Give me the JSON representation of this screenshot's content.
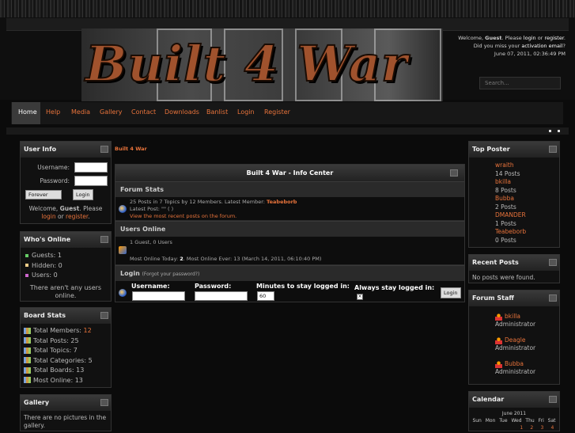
{
  "welcome": {
    "prefix": "Welcome, ",
    "user": "Guest",
    "mid": ". Please ",
    "login": "login",
    "or": " or ",
    "register": "register",
    "end": ".",
    "line2a": "Did you miss your ",
    "activation": "activation email",
    "line2b": "?",
    "date": "June 07, 2011, 02:36:49 PM"
  },
  "logo_text": "Built 4 War",
  "search_placeholder": "Search...",
  "nav": [
    "Home",
    "Help",
    "Media",
    "Gallery",
    "Contact",
    "Downloads",
    "Banlist",
    "Login",
    "Register"
  ],
  "breadcrumb": "Built 4 War",
  "userinfo": {
    "title": "User Info",
    "username": "Username:",
    "password": "Password:",
    "forever": "Forever",
    "login_btn": "Login",
    "w1": "Welcome, ",
    "w_user": "Guest",
    "w2": ". Please",
    "w_login": "login",
    "w_or": " or ",
    "w_register": "register",
    "w_end": "."
  },
  "whos_online": {
    "title": "Who's Online",
    "guests": "Guests: 1",
    "hidden": "Hidden: 0",
    "users": "Users: 0",
    "empty": "There aren't any users online."
  },
  "board_stats": {
    "title": "Board Stats",
    "items": [
      {
        "label": "Total Members: ",
        "value": "12"
      },
      {
        "label": "Total Posts: 25",
        "value": ""
      },
      {
        "label": "Total Topics: 7",
        "value": ""
      },
      {
        "label": "Total Categories: 5",
        "value": ""
      },
      {
        "label": "Total Boards: 13",
        "value": ""
      },
      {
        "label": "Most Online: 13",
        "value": ""
      }
    ]
  },
  "gallery": {
    "title": "Gallery",
    "text": "There are no pictures in the gallery."
  },
  "info": {
    "title": "Built 4 War - Info Center",
    "forum_stats": "Forum Stats",
    "stats_line": "25 Posts in 7 Topics by 12 Members. Latest Member: ",
    "latest_member": "Teabeborb",
    "latest_post": "Latest Post: \"\" ( )",
    "recent_link": "View the most recent posts on the forum.",
    "users_online": "Users Online",
    "online_line": "1 Guest, 0 Users",
    "most_online": "Most Online Today: ",
    "most_today": "2",
    "most_rest": ". Most Online Ever: 13 (March 14, 2011, 06:10:40 PM)",
    "login_sect": "Login",
    "forgot": "(Forgot your password?)",
    "username": "Username:",
    "password": "Password:",
    "minutes": "Minutes to stay logged in:",
    "minutes_val": "60",
    "always": "Always stay logged in:",
    "login_btn": "Login"
  },
  "top_poster": {
    "title": "Top Poster",
    "items": [
      {
        "name": "wraith",
        "posts": "14 Posts"
      },
      {
        "name": "bkilla",
        "posts": "8 Posts"
      },
      {
        "name": "Bubba",
        "posts": "2 Posts"
      },
      {
        "name": "DMANDER",
        "posts": "1 Posts"
      },
      {
        "name": "Teabeborb",
        "posts": "0 Posts"
      }
    ]
  },
  "recent_posts": {
    "title": "Recent Posts",
    "text": "No posts were found."
  },
  "forum_staff": {
    "title": "Forum Staff",
    "items": [
      {
        "name": "bkilla",
        "role": "Administrator"
      },
      {
        "name": "Deagle",
        "role": "Administrator"
      },
      {
        "name": "Bubba",
        "role": "Administrator"
      }
    ]
  },
  "calendar": {
    "title": "Calendar",
    "month": "June 2011",
    "days": [
      "Sun",
      "Mon",
      "Tue",
      "Wed",
      "Thu",
      "Fri",
      "Sat"
    ],
    "first_row": [
      "",
      "",
      "",
      "1",
      "2",
      "3",
      "4"
    ]
  }
}
